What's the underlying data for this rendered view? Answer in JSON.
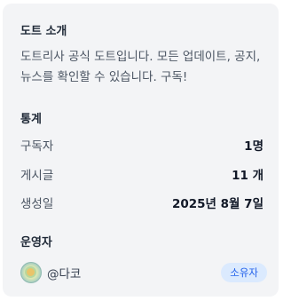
{
  "about": {
    "title": "도트 소개",
    "text": "도트리사 공식 도트입니다. 모든 업데이트, 공지, 뉴스를 확인할 수 있습니다. 구독!"
  },
  "stats": {
    "title": "통계",
    "rows": [
      {
        "label": "구독자",
        "value": "1명"
      },
      {
        "label": "게시글",
        "value": "11 개"
      },
      {
        "label": "생성일",
        "value": "2025년 8월 7일"
      }
    ]
  },
  "operators": {
    "title": "운영자",
    "owner": {
      "name": "@다코",
      "badge": "소유자",
      "avatar_icon": "avatar-image"
    }
  },
  "colors": {
    "card_background": "#f3f4f6",
    "badge_background": "#dbeafe",
    "badge_text": "#2563eb"
  }
}
